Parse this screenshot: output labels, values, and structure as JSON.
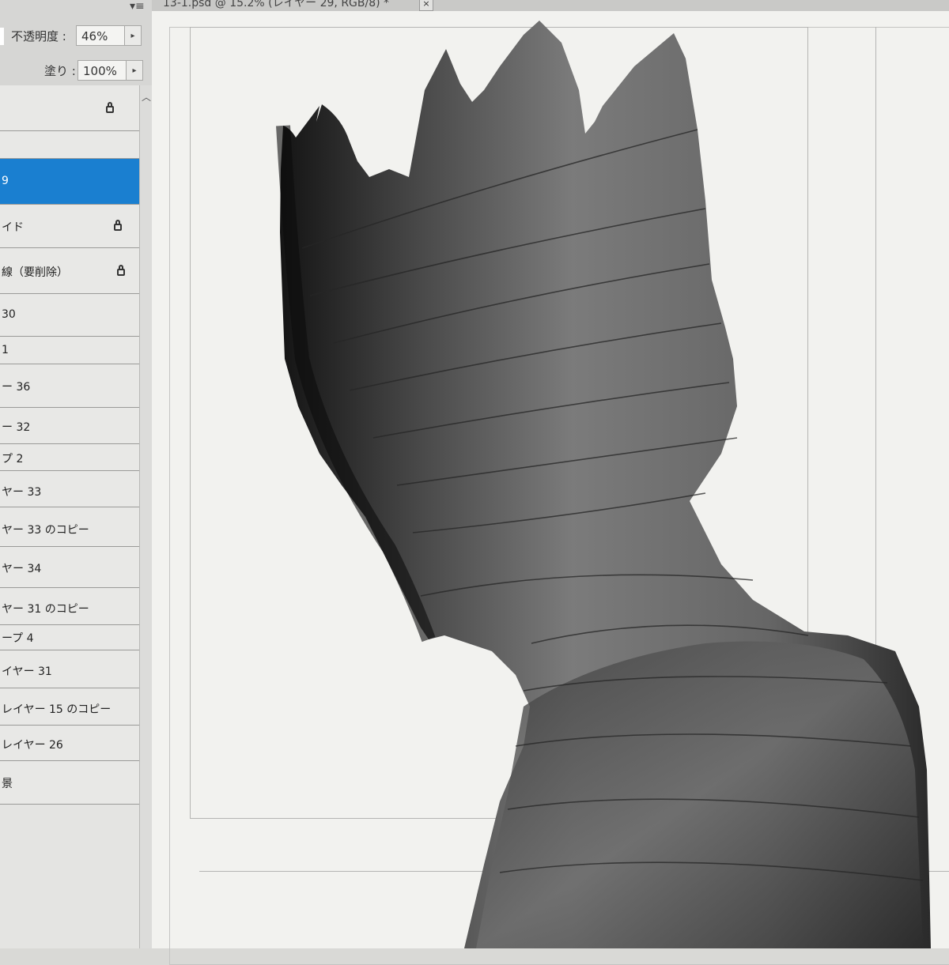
{
  "panel": {
    "menu_icon": "▾≡",
    "opacity_label": "不透明度 :",
    "opacity_value": "46%",
    "fill_label": "塗り :",
    "fill_value": "100%",
    "arrow": "▸"
  },
  "layers": [
    {
      "name": "",
      "locked": true,
      "selected": false
    },
    {
      "name": "",
      "locked": false,
      "selected": false
    },
    {
      "name": "9",
      "locked": false,
      "selected": true
    },
    {
      "name": "イド",
      "locked": true,
      "selected": false
    },
    {
      "name": "線（要削除）",
      "locked": true,
      "selected": false
    },
    {
      "name": "30",
      "locked": false,
      "selected": false
    },
    {
      "name": "1",
      "locked": false,
      "selected": false
    },
    {
      "name": "ー 36",
      "locked": false,
      "selected": false
    },
    {
      "name": "ー 32",
      "locked": false,
      "selected": false
    },
    {
      "name": "プ 2",
      "locked": false,
      "selected": false
    },
    {
      "name": "ヤー 33",
      "locked": false,
      "selected": false
    },
    {
      "name": "ヤー 33 のコピー",
      "locked": false,
      "selected": false
    },
    {
      "name": "ヤー 34",
      "locked": false,
      "selected": false
    },
    {
      "name": "ヤー 31 のコピー",
      "locked": false,
      "selected": false
    },
    {
      "name": "ープ 4",
      "locked": false,
      "selected": false
    },
    {
      "name": "イヤー 31",
      "locked": false,
      "selected": false
    },
    {
      "name": "レイヤー 15 のコピー",
      "locked": false,
      "selected": false
    },
    {
      "name": "レイヤー 26",
      "locked": false,
      "selected": false
    },
    {
      "name": "景",
      "locked": true,
      "selected": false
    }
  ],
  "document": {
    "tab_title": "13-1.psd @ 15.2% (レイヤー 29, RGB/8) *",
    "close_label": "×"
  },
  "artwork": {
    "description_icon": "crowned-bandaged-figure-illustration"
  },
  "colors": {
    "selection": "#1a7fd0",
    "panel": "#e4e4e2",
    "canvas": "#f2f2ef"
  }
}
